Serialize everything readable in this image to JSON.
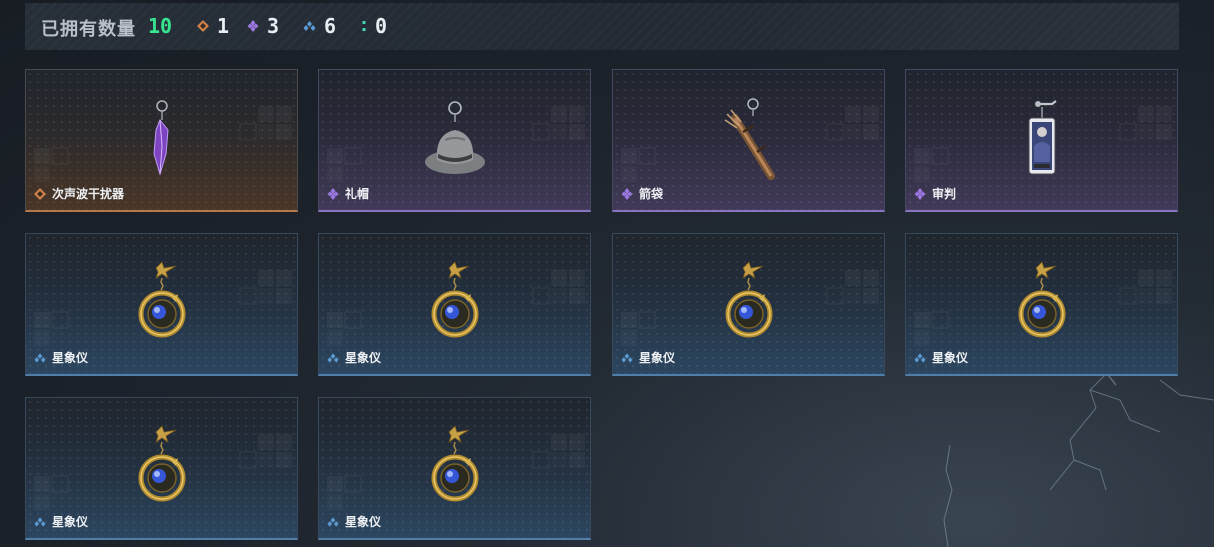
{
  "header": {
    "title": "已拥有数量",
    "total": "10",
    "stats": [
      {
        "rarity": "orange",
        "icon": "diamond-orange-icon",
        "count": "1"
      },
      {
        "rarity": "purple",
        "icon": "diamond-purple-icon",
        "count": "3"
      },
      {
        "rarity": "blue",
        "icon": "diamond-blue-icon",
        "count": "6"
      },
      {
        "rarity": "teal",
        "icon": "dots-teal-icon",
        "count": "0"
      }
    ]
  },
  "colors": {
    "orange": "#d0804a",
    "purple": "#9b78e0",
    "blue": "#5b9bd5",
    "teal": "#3fd6b4",
    "total": "#37e48e"
  },
  "items": [
    {
      "name": "次声波干扰器",
      "rarity": "orange",
      "image": "purple-crystal-pendant"
    },
    {
      "name": "礼帽",
      "rarity": "purple",
      "image": "gray-fedora-hat"
    },
    {
      "name": "箭袋",
      "rarity": "purple",
      "image": "arrow-quiver"
    },
    {
      "name": "审判",
      "rarity": "purple",
      "image": "card-keychain"
    },
    {
      "name": "星象仪",
      "rarity": "blue",
      "image": "astrolabe-pendant"
    },
    {
      "name": "星象仪",
      "rarity": "blue",
      "image": "astrolabe-pendant"
    },
    {
      "name": "星象仪",
      "rarity": "blue",
      "image": "astrolabe-pendant"
    },
    {
      "name": "星象仪",
      "rarity": "blue",
      "image": "astrolabe-pendant"
    },
    {
      "name": "星象仪",
      "rarity": "blue",
      "image": "astrolabe-pendant"
    },
    {
      "name": "星象仪",
      "rarity": "blue",
      "image": "astrolabe-pendant"
    }
  ]
}
